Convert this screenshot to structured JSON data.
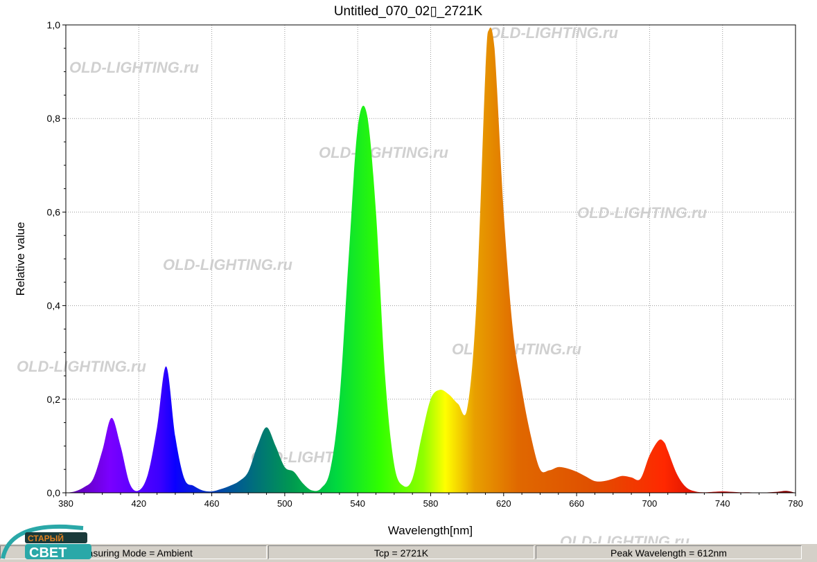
{
  "chart_data": {
    "type": "area",
    "title": "Untitled_070_02▯_2721K",
    "xlabel": "Wavelength[nm]",
    "ylabel": "Relative value",
    "xlim": [
      380,
      780
    ],
    "ylim": [
      0,
      1.0
    ],
    "x_ticks": [
      "380",
      "420",
      "460",
      "500",
      "540",
      "580",
      "620",
      "660",
      "700",
      "740",
      "780"
    ],
    "y_ticks": [
      "0,0",
      "0,2",
      "0,4",
      "0,6",
      "0,8",
      "1,0"
    ],
    "grid": true,
    "fill": "spectral colors",
    "x": [
      380,
      385,
      390,
      395,
      400,
      405,
      410,
      415,
      420,
      425,
      430,
      435,
      440,
      445,
      450,
      455,
      460,
      465,
      470,
      475,
      480,
      485,
      490,
      495,
      500,
      505,
      510,
      515,
      520,
      525,
      530,
      535,
      540,
      545,
      550,
      555,
      560,
      565,
      570,
      575,
      580,
      585,
      590,
      595,
      600,
      605,
      610,
      612,
      615,
      620,
      625,
      630,
      635,
      640,
      645,
      650,
      655,
      660,
      665,
      670,
      675,
      680,
      685,
      690,
      695,
      700,
      705,
      708,
      710,
      715,
      720,
      725,
      730,
      735,
      740,
      745,
      750,
      755,
      760,
      765,
      770,
      775,
      780
    ],
    "y": [
      0.0,
      0.003,
      0.012,
      0.03,
      0.09,
      0.16,
      0.1,
      0.02,
      0.005,
      0.04,
      0.14,
      0.27,
      0.12,
      0.03,
      0.015,
      0.005,
      0.003,
      0.008,
      0.015,
      0.025,
      0.045,
      0.1,
      0.14,
      0.1,
      0.055,
      0.045,
      0.02,
      0.005,
      0.01,
      0.05,
      0.2,
      0.5,
      0.78,
      0.81,
      0.6,
      0.25,
      0.06,
      0.015,
      0.03,
      0.12,
      0.2,
      0.22,
      0.21,
      0.19,
      0.18,
      0.4,
      0.9,
      0.99,
      0.95,
      0.6,
      0.35,
      0.22,
      0.12,
      0.05,
      0.048,
      0.055,
      0.052,
      0.045,
      0.035,
      0.025,
      0.025,
      0.03,
      0.036,
      0.033,
      0.03,
      0.08,
      0.112,
      0.108,
      0.09,
      0.04,
      0.012,
      0.003,
      0.001,
      0.002,
      0.003,
      0.002,
      0.001,
      0.001,
      0.0,
      0.001,
      0.002,
      0.004,
      0.0
    ]
  },
  "watermarks": [
    "OLD-LIGHTING.ru",
    "OLD-LIGHTING.ru",
    "OLD-LIGHTING.ru",
    "OLD-LIGHTING.ru",
    "OLD-LIGHTING.ru",
    "OLD-LIGHTING.ru",
    "OLD-LIGHTING.ru",
    "OLD-LIGHTING.ru",
    "OLD-LIGHTING.ru"
  ],
  "status": {
    "measuring_mode": "Measuring Mode = Ambient",
    "tcp": "Tcp = 2721K",
    "peak_wavelength": "Peak Wavelength = 612nm"
  },
  "logo": {
    "line1": "СТАРЫЙ",
    "line2": "СВЕТ"
  },
  "colors": {
    "plot_border": "#000000",
    "grid": "#9a9a9a",
    "watermark": "#c8c8c8",
    "status_bg": "#d4d0c8"
  }
}
